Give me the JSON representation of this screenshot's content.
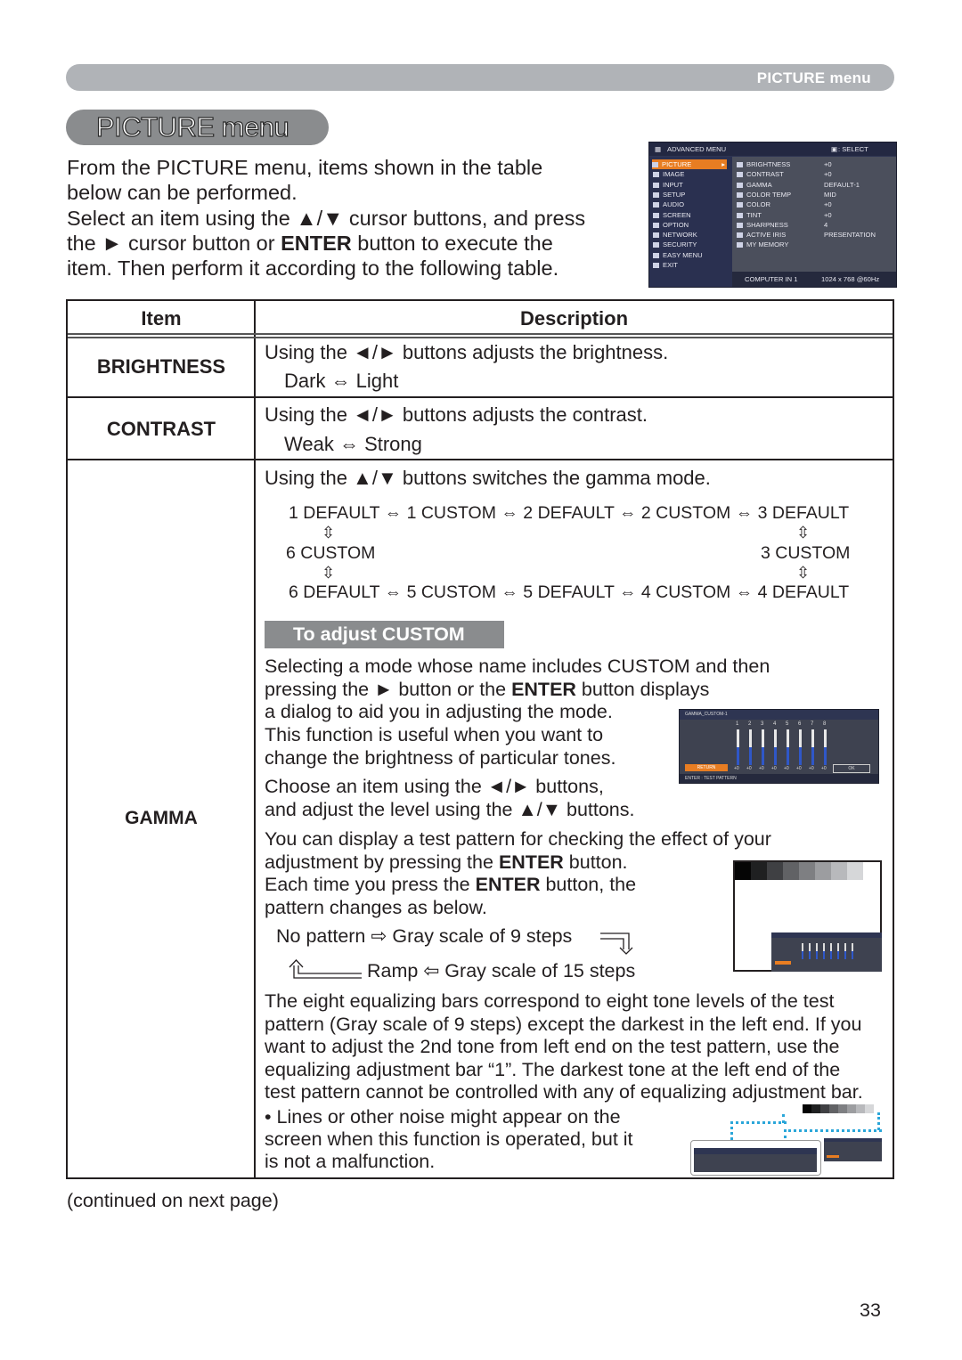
{
  "header": {
    "banner_label": "PICTURE menu",
    "section_title": "PICTURE menu"
  },
  "intro": {
    "line1": "From the PICTURE menu, items shown in the table",
    "line2": "below can be performed.",
    "line3": "Select an item using the ▲/▼ cursor buttons, and press",
    "line4_pre": "the ► cursor button or ",
    "line4_bold": "ENTER",
    "line4_post": " button to execute the",
    "line5": "item. Then perform it according to the following table."
  },
  "osd_menu": {
    "title": "ADVANCED MENU",
    "select_hint": ": SELECT",
    "left_items": [
      "PICTURE",
      "IMAGE",
      "INPUT",
      "SETUP",
      "AUDIO",
      "SCREEN",
      "OPTION",
      "NETWORK",
      "SECURITY",
      "EASY MENU",
      "EXIT"
    ],
    "selected_index": 0,
    "sub_items": [
      {
        "label": "BRIGHTNESS",
        "value": "+0"
      },
      {
        "label": "CONTRAST",
        "value": "+0"
      },
      {
        "label": "GAMMA",
        "value": "DEFAULT-1"
      },
      {
        "label": "COLOR TEMP",
        "value": "MID"
      },
      {
        "label": "COLOR",
        "value": "+0"
      },
      {
        "label": "TINT",
        "value": "+0"
      },
      {
        "label": "SHARPNESS",
        "value": "4"
      },
      {
        "label": "ACTIVE IRIS",
        "value": "PRESENTATION"
      },
      {
        "label": "MY MEMORY",
        "value": ""
      }
    ],
    "footer_input": "COMPUTER IN 1",
    "footer_signal": "1024 x 768 @60Hz"
  },
  "table": {
    "headers": {
      "item": "Item",
      "description": "Description"
    },
    "rows": [
      {
        "item": "BRIGHTNESS",
        "line1": "Using the ◄/► buttons adjusts the brightness.",
        "line2": "Dark ⇔ Light"
      },
      {
        "item": "CONTRAST",
        "line1": "Using the ◄/► buttons adjusts the contrast.",
        "line2": "Weak ⇔ Strong"
      }
    ],
    "gamma": {
      "item": "GAMMA",
      "intro": "Using the ▲/▼ buttons switches the gamma mode.",
      "cycle_row1": "1 DEFAULT ⇔ 1 CUSTOM ⇔ 2 DEFAULT ⇔ 2 CUSTOM  ⇔ 3 DEFAULT",
      "cycle_mid_left": "6 CUSTOM",
      "cycle_mid_right": "3 CUSTOM",
      "cycle_row3": "6 DEFAULT ⇔ 5 CUSTOM ⇔ 5 DEFAULT ⇔ 4 CUSTOM  ⇔ 4 DEFAULT",
      "updown_arrow": "⇳",
      "custom_heading": "To adjust CUSTOM",
      "p1_l1": "Selecting a mode whose name includes CUSTOM and then",
      "p1_l2_pre": "pressing the ► button or the ",
      "p1_l2_bold": "ENTER",
      "p1_l2_post": " button displays",
      "p1_l3": "a dialog to aid you in adjusting the mode.",
      "p1_l4": "This function is useful when you want to",
      "p1_l5": "change the brightness of particular tones.",
      "p2_l1": "Choose an item using the ◄/► buttons,",
      "p2_l2": "and  adjust the level using the ▲/▼ buttons.",
      "p3_l1": "You can display a test pattern for checking the effect of your",
      "p3_l2_pre": "adjustment by pressing the ",
      "p3_l2_bold": "ENTER",
      "p3_l2_post": " button.",
      "p3_l3_pre": "Each time you press the ",
      "p3_l3_bold": "ENTER",
      "p3_l3_post": " button, the",
      "p3_l4": "pattern changes as below.",
      "pattern_row1": "No pattern ⇨ Gray scale of 9 steps",
      "pattern_row2": "Ramp ⇦ Gray scale of 15 steps",
      "p4_l1": "The eight equalizing bars correspond to eight tone levels of the test",
      "p4_l2": "pattern (Gray scale of 9 steps) except the darkest in the left end. If you",
      "p4_l3": "want to adjust the 2nd tone from left end on the test pattern, use the",
      "p4_l4": "equalizing adjustment bar “1”. The darkest tone at the left end of the",
      "p4_l5": "test pattern cannot be controlled with any of equalizing adjustment bar.",
      "note_l1": "• Lines or other noise might appear on the",
      "note_l2": "screen when this function is operated, but it",
      "note_l3": "is not a malfunction."
    }
  },
  "gamma_dialog": {
    "title": "GAMMA_CUSTOM-1",
    "bar_numbers": [
      "1",
      "2",
      "3",
      "4",
      "5",
      "6",
      "7",
      "8"
    ],
    "bar_values": [
      "+0",
      "+0",
      "+0",
      "+0",
      "+0",
      "+0",
      "+0",
      "+0"
    ],
    "return_label": "RETURN",
    "ok_label": "OK",
    "footer": "ENTER  : TEST PATTERN"
  },
  "test_pattern_grays": [
    "#050505",
    "#1f2021",
    "#3f4043",
    "#616265",
    "#7e7f82",
    "#9c9da0",
    "#b8b9bc",
    "#d6d7d9",
    "#ffffff"
  ],
  "footer": {
    "continued": "(continued on next page)",
    "page_number": "33"
  }
}
